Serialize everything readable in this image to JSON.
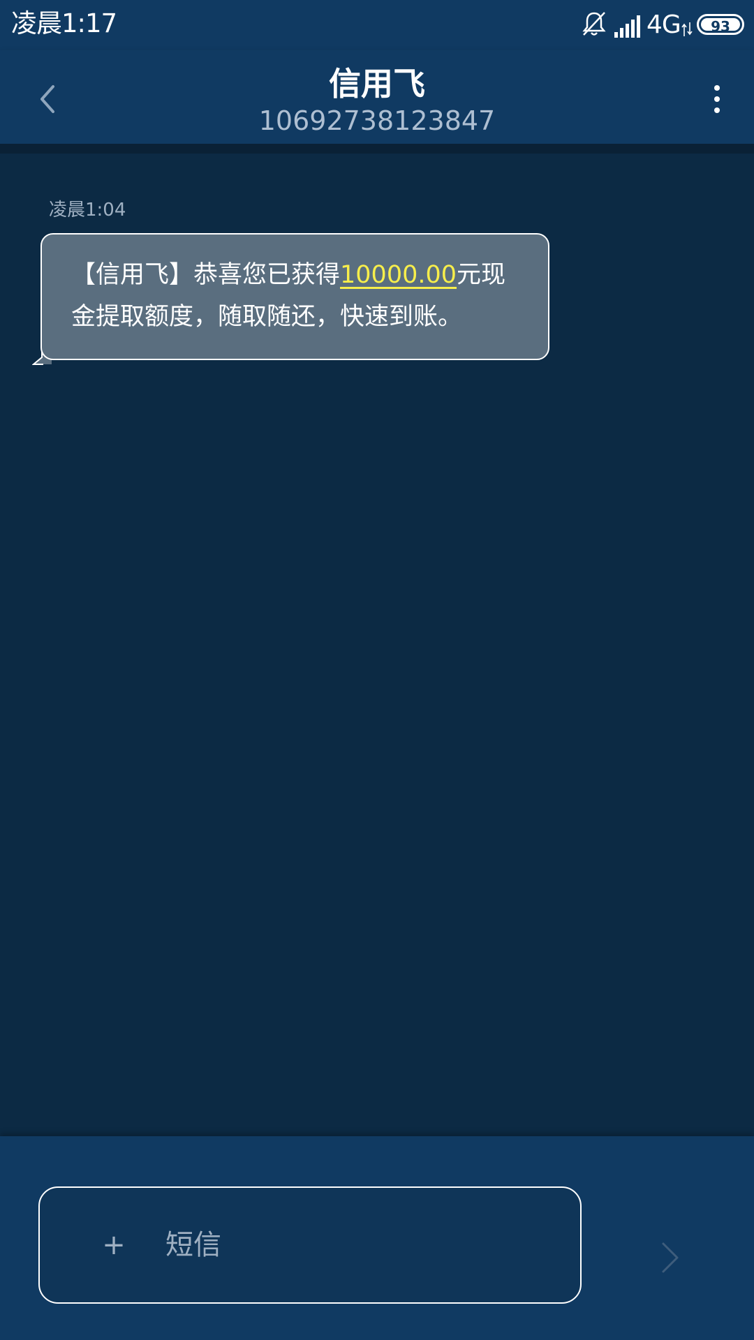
{
  "status_bar": {
    "time": "凌晨1:17",
    "network": "4G",
    "battery": "93",
    "icons": [
      "mute-icon",
      "signal-icon",
      "net-arrows-icon",
      "battery-icon"
    ]
  },
  "header": {
    "contact_name": "信用飞",
    "contact_number": "10692738123847",
    "icons": [
      "back-icon",
      "more-icon"
    ]
  },
  "conversation": {
    "messages": [
      {
        "time": "凌晨1:04",
        "text_before": "【信用飞】恭喜您已获得",
        "amount": "10000.00",
        "text_after": "元现金提取额度，随取随还，快速到账。"
      }
    ]
  },
  "compose": {
    "attach_label": "+",
    "placeholder": "短信",
    "send_icon": "send-icon"
  },
  "colors": {
    "background": "#0c2a44",
    "bar": "#103a62",
    "bubble": "#5a6e7f",
    "amount_link": "#f7ee4b"
  }
}
